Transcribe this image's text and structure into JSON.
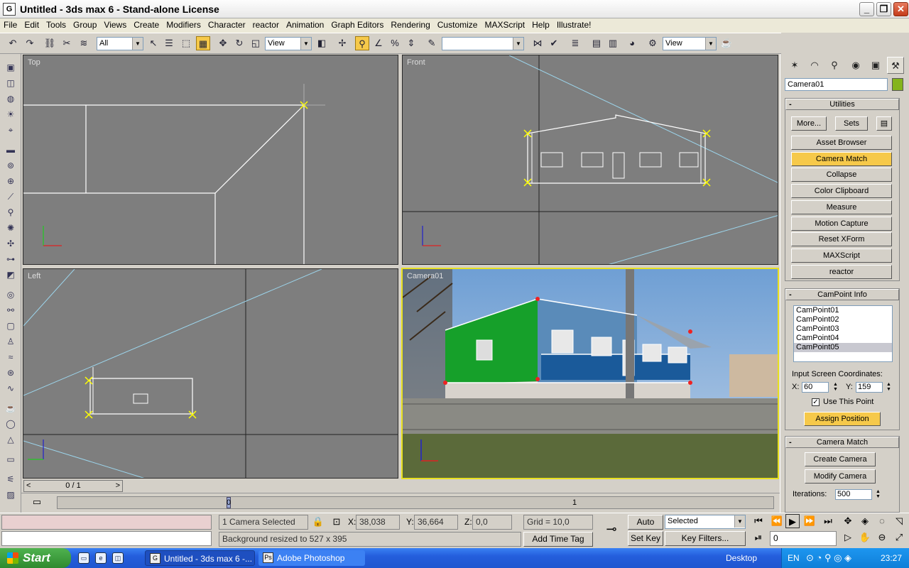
{
  "window": {
    "title": "Untitled - 3ds max 6 - Stand-alone License",
    "app_icon_letter": "G",
    "minimize": "_",
    "restore": "❐",
    "close": "✕"
  },
  "menu": [
    "File",
    "Edit",
    "Tools",
    "Group",
    "Views",
    "Create",
    "Modifiers",
    "Character",
    "reactor",
    "Animation",
    "Graph Editors",
    "Rendering",
    "Customize",
    "MAXScript",
    "Help",
    "Illustrate!"
  ],
  "toolbar": {
    "selection_filter": "All",
    "ref_coord": "View",
    "named_selection": "",
    "render_view": "View"
  },
  "viewports": {
    "top_label": "Top",
    "front_label": "Front",
    "left_label": "Left",
    "camera_label": "Camera01"
  },
  "command_panel": {
    "object_name": "Camera01",
    "object_color": "#84b41c",
    "utilities_title": "Utilities",
    "more_label": "More...",
    "sets_label": "Sets",
    "utility_buttons": [
      "Asset Browser",
      "Camera Match",
      "Collapse",
      "Color Clipboard",
      "Measure",
      "Motion Capture",
      "Reset XForm",
      "MAXScript",
      "reactor"
    ],
    "active_utility": "Camera Match",
    "campoint_title": "CamPoint Info",
    "campoints": [
      "CamPoint01",
      "CamPoint02",
      "CamPoint03",
      "CamPoint04",
      "CamPoint05"
    ],
    "selected_campoint": "CamPoint05",
    "input_coords_label": "Input Screen Coordinates:",
    "x_label": "X:",
    "x_value": "60",
    "y_label": "Y:",
    "y_value": "159",
    "use_point_label": "Use This Point",
    "use_point_checked": "✓",
    "assign_position_label": "Assign Position",
    "camera_match_title": "Camera Match",
    "create_camera_label": "Create Camera",
    "modify_camera_label": "Modify Camera",
    "iterations_label": "Iterations:",
    "iterations_value": "500"
  },
  "timeline": {
    "frame": "0 / 1",
    "prev": "<",
    "next": ">",
    "track_start": "0",
    "track_end": "1"
  },
  "status": {
    "selection_info": "1 Camera Selected",
    "x_label": "X:",
    "x_value": "38,038",
    "y_label": "Y:",
    "y_value": "36,664",
    "z_label": "Z:",
    "z_value": "0,0",
    "grid": "Grid = 10,0",
    "prompt": "Background resized to 527 x 395",
    "add_time_tag": "Add Time Tag",
    "auto_key": "Auto Key",
    "set_key": "Set Key",
    "key_mode": "Selected",
    "key_filters": "Key Filters...",
    "current_frame": "0"
  },
  "taskbar": {
    "start": "Start",
    "task1": "Untitled - 3ds max 6 -...",
    "task2": "Adobe Photoshop",
    "desktop": "Desktop",
    "lang": "EN",
    "time": "23:27"
  }
}
